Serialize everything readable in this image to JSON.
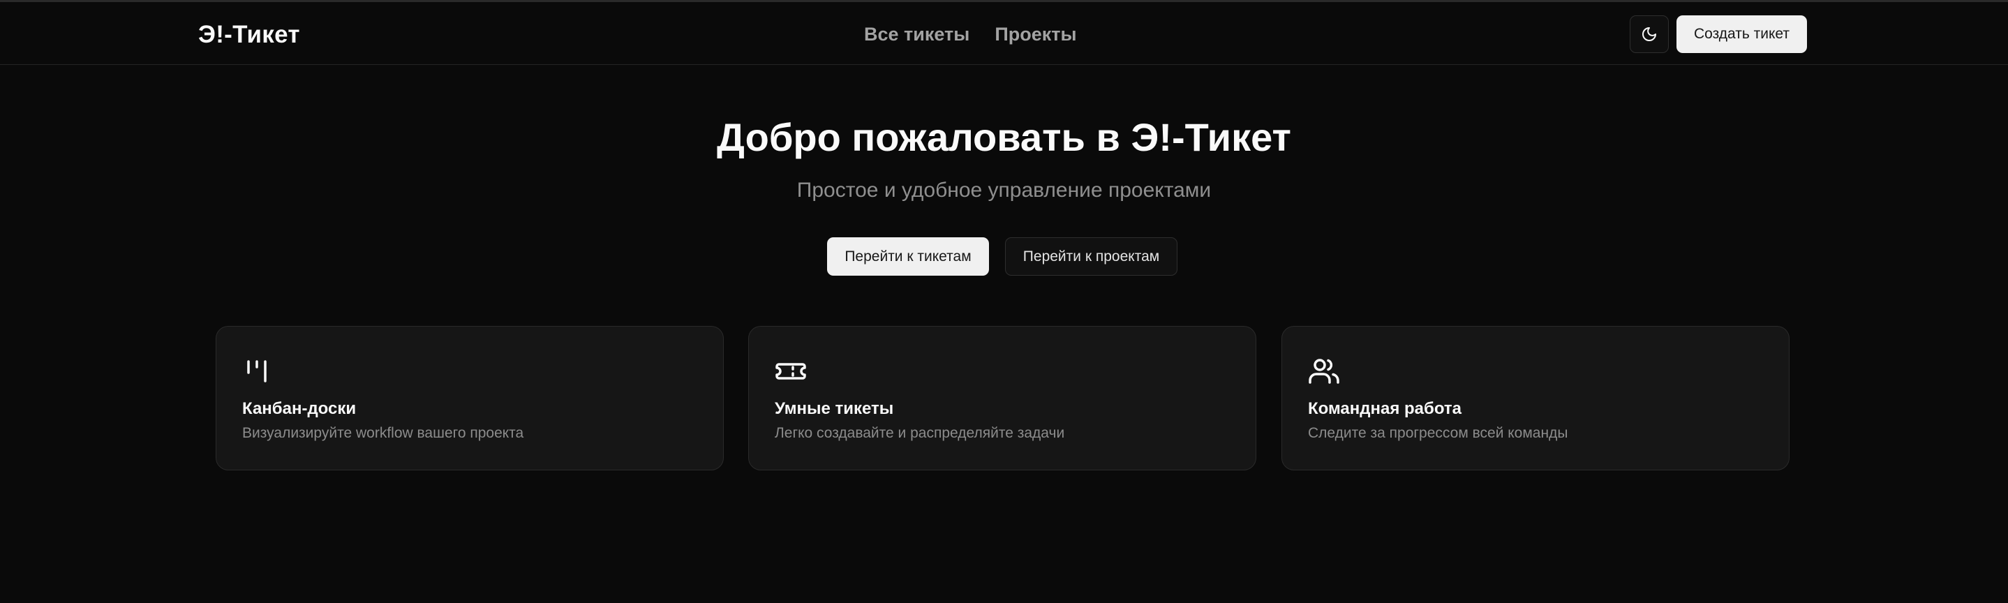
{
  "header": {
    "logo": "Э!-Тикет",
    "nav": [
      "Все тикеты",
      "Проекты"
    ],
    "theme_toggle_icon": "moon-icon",
    "create_label": "Создать тикет"
  },
  "hero": {
    "title": "Добро пожаловать в Э!-Тикет",
    "subtitle": "Простое и удобное управление проектами",
    "primary_label": "Перейти к тикетам",
    "secondary_label": "Перейти к проектам"
  },
  "features": [
    {
      "icon": "kanban-icon",
      "title": "Канбан-доски",
      "desc": "Визуализируйте workflow вашего проекта"
    },
    {
      "icon": "ticket-icon",
      "title": "Умные тикеты",
      "desc": "Легко создавайте и распределяйте задачи"
    },
    {
      "icon": "users-icon",
      "title": "Командная работа",
      "desc": "Следите за прогрессом всей команды"
    }
  ],
  "colors": {
    "background": "#0a0a0a",
    "card": "#161616",
    "primary_button": "#f0f0f0",
    "muted_text": "#8c8c8c"
  }
}
